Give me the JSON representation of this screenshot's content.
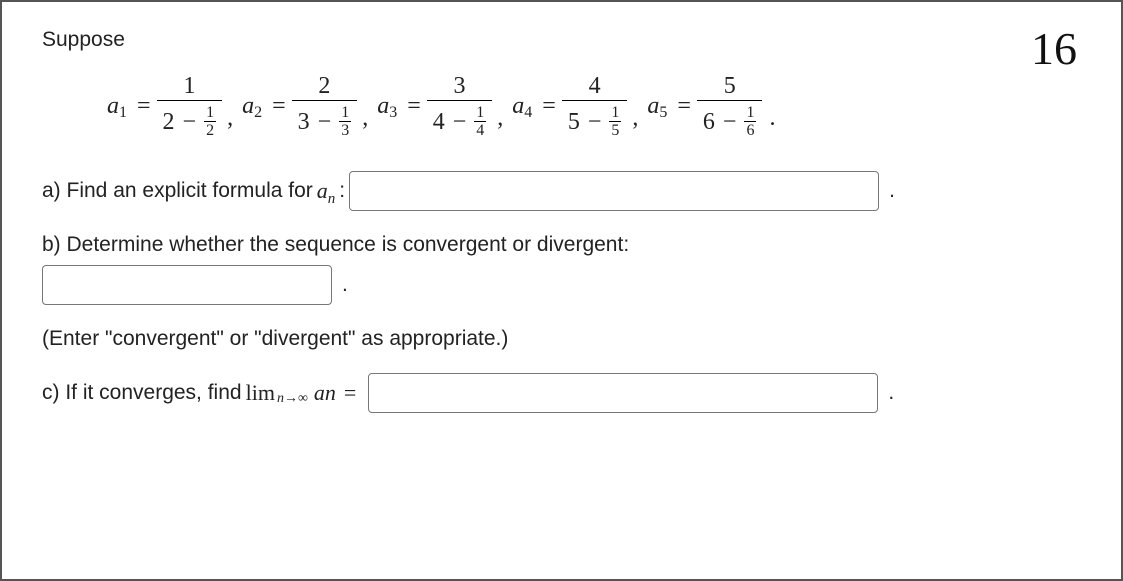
{
  "page_number": "16",
  "intro": "Suppose",
  "terms": [
    {
      "label": "a",
      "index": "1",
      "num": "1",
      "den_int": "2",
      "den_frac_num": "1",
      "den_frac_den": "2"
    },
    {
      "label": "a",
      "index": "2",
      "num": "2",
      "den_int": "3",
      "den_frac_num": "1",
      "den_frac_den": "3"
    },
    {
      "label": "a",
      "index": "3",
      "num": "3",
      "den_int": "4",
      "den_frac_num": "1",
      "den_frac_den": "4"
    },
    {
      "label": "a",
      "index": "4",
      "num": "4",
      "den_int": "5",
      "den_frac_num": "1",
      "den_frac_den": "5"
    },
    {
      "label": "a",
      "index": "5",
      "num": "5",
      "den_int": "6",
      "den_frac_num": "1",
      "den_frac_den": "6"
    }
  ],
  "qa": {
    "prefix": "a) Find an explicit formula for ",
    "an_a": "a",
    "an_n": "n",
    "colon": ":"
  },
  "qb": "b) Determine whether the sequence is convergent or divergent:",
  "qb_hint": "(Enter \"convergent\" or \"divergent\" as appropriate.)",
  "qc": {
    "prefix": "c) If it converges, find ",
    "lim": "lim",
    "limsub_n": "n",
    "arrow": "→",
    "infty": "∞",
    "an_a": "a",
    "an_n": "n",
    "eq": "="
  },
  "period": ".",
  "minus": "−",
  "equals": "=",
  "comma": ","
}
